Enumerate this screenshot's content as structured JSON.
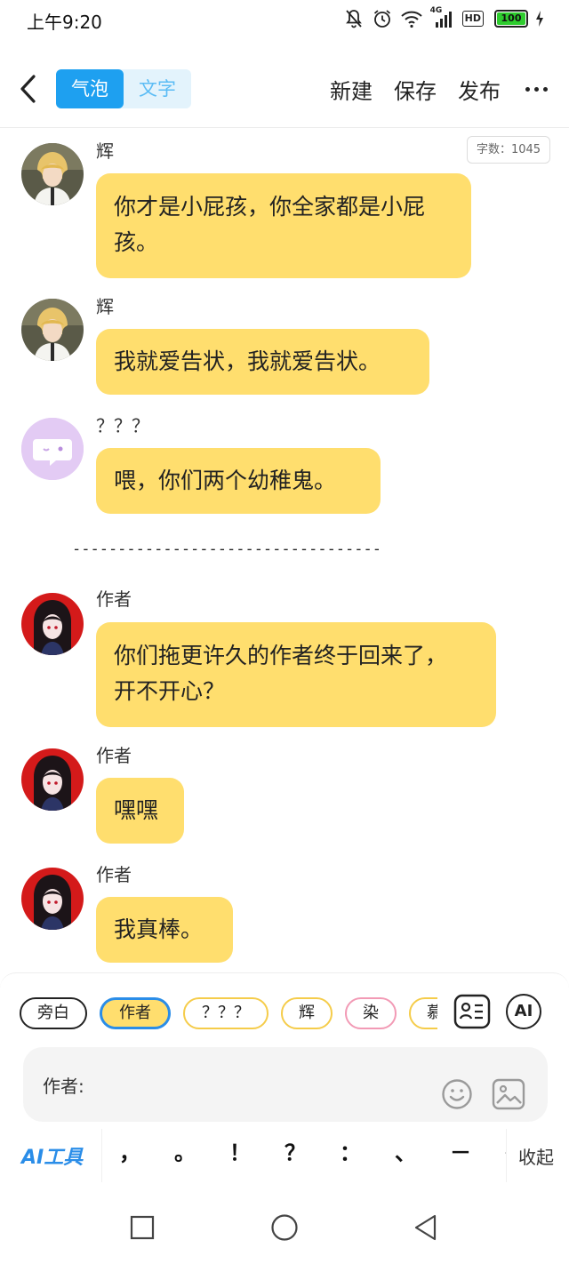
{
  "status_bar": {
    "time": "上午9:20",
    "network": "4G",
    "hd": "HD",
    "battery_text": "100",
    "battery_level": 100
  },
  "header": {
    "tabs": [
      {
        "label": "气泡",
        "active": true
      },
      {
        "label": "文字",
        "active": false
      }
    ],
    "actions": [
      "新建",
      "保存",
      "发布"
    ]
  },
  "word_count": "字数：1045",
  "messages": [
    {
      "speaker": "辉",
      "lines": [
        "你才是小屁孩，你全家都是小屁",
        "孩。"
      ],
      "avatar": "blond-boy-avatar"
    },
    {
      "speaker": "辉",
      "lines": [
        "我就爱告状，我就爱告状。"
      ],
      "avatar": "blond-boy-avatar"
    },
    {
      "speaker": "？？？",
      "lines": [
        "喂，你们两个幼稚鬼。"
      ],
      "avatar": "chat-bubble-avatar"
    },
    {
      "speaker": "作者",
      "lines": [
        "你们拖更许久的作者终于回来了，",
        "开不开心？"
      ],
      "avatar": "dark-hair-girl-avatar"
    },
    {
      "speaker": "作者",
      "lines": [
        "嘿嘿"
      ],
      "avatar": "dark-hair-girl-avatar"
    },
    {
      "speaker": "作者",
      "lines": [
        "我真棒。"
      ],
      "avatar": "dark-hair-girl-avatar"
    }
  ],
  "divider": "----------------------------------",
  "roles": [
    "旁白",
    "作者",
    "？？？",
    "辉",
    "染",
    "慕"
  ],
  "selected_role": "作者",
  "ai_button": "AI",
  "input": {
    "prefix": "作者:"
  },
  "ai_tools": "AI工具",
  "punctuation": [
    "，",
    "。",
    "！",
    "？",
    "：",
    "、",
    "－",
    "～"
  ],
  "collapse": "收起",
  "colors": {
    "accent": "#1ea0f0",
    "bubble": "#ffde6e",
    "chip_border": "#f5cc4a",
    "pink_chip": "#f29ab5"
  }
}
